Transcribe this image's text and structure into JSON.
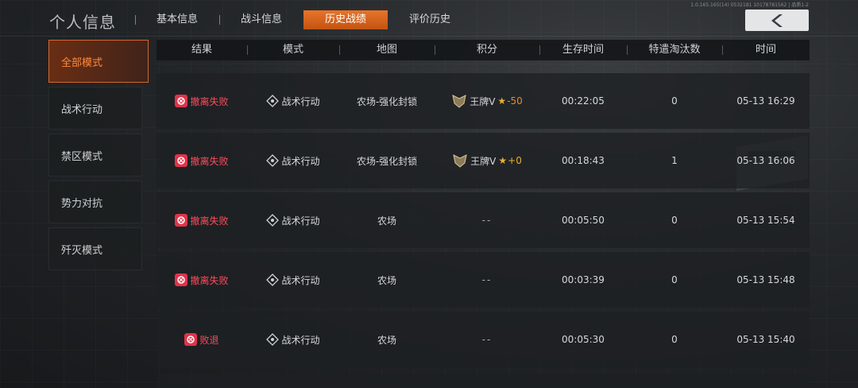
{
  "header": {
    "title": "个人信息",
    "tabs": [
      {
        "label": "基本信息",
        "active": false
      },
      {
        "label": "战斗信息",
        "active": false
      },
      {
        "label": "历史战绩",
        "active": true
      },
      {
        "label": "评价历史",
        "active": false
      }
    ],
    "version": "1.0.165.165(14) 0532181 10178781562 | 品质1-2",
    "back_icon": "chevron-left-icon"
  },
  "sidebar": {
    "items": [
      {
        "label": "全部模式",
        "active": true
      },
      {
        "label": "战术行动",
        "active": false
      },
      {
        "label": "禁区模式",
        "active": false
      },
      {
        "label": "势力对抗",
        "active": false
      },
      {
        "label": "歼灭模式",
        "active": false
      }
    ]
  },
  "table": {
    "columns": [
      "结果",
      "模式",
      "地图",
      "积分",
      "生存时间",
      "特遣淘汰数",
      "时间"
    ],
    "rows": [
      {
        "result": "撤离失败",
        "mode": "战术行动",
        "map": "农场-强化封锁",
        "rank": "王牌V",
        "delta": "-50",
        "survival": "00:22:05",
        "kills": "0",
        "time": "05-13 16:29"
      },
      {
        "result": "撤离失败",
        "mode": "战术行动",
        "map": "农场-强化封锁",
        "rank": "王牌V",
        "delta": "+0",
        "survival": "00:18:43",
        "kills": "1",
        "time": "05-13 16:06"
      },
      {
        "result": "撤离失败",
        "mode": "战术行动",
        "map": "农场",
        "score": "--",
        "survival": "00:05:50",
        "kills": "0",
        "time": "05-13 15:54"
      },
      {
        "result": "撤离失败",
        "mode": "战术行动",
        "map": "农场",
        "score": "--",
        "survival": "00:03:39",
        "kills": "0",
        "time": "05-13 15:48"
      },
      {
        "result": "败退",
        "mode": "战术行动",
        "map": "农场",
        "score": "--",
        "survival": "00:05:30",
        "kills": "0",
        "time": "05-13 15:40"
      }
    ]
  },
  "colors": {
    "accent": "#e8742a",
    "fail": "#ff4a5a",
    "gold": "#e8b030"
  }
}
